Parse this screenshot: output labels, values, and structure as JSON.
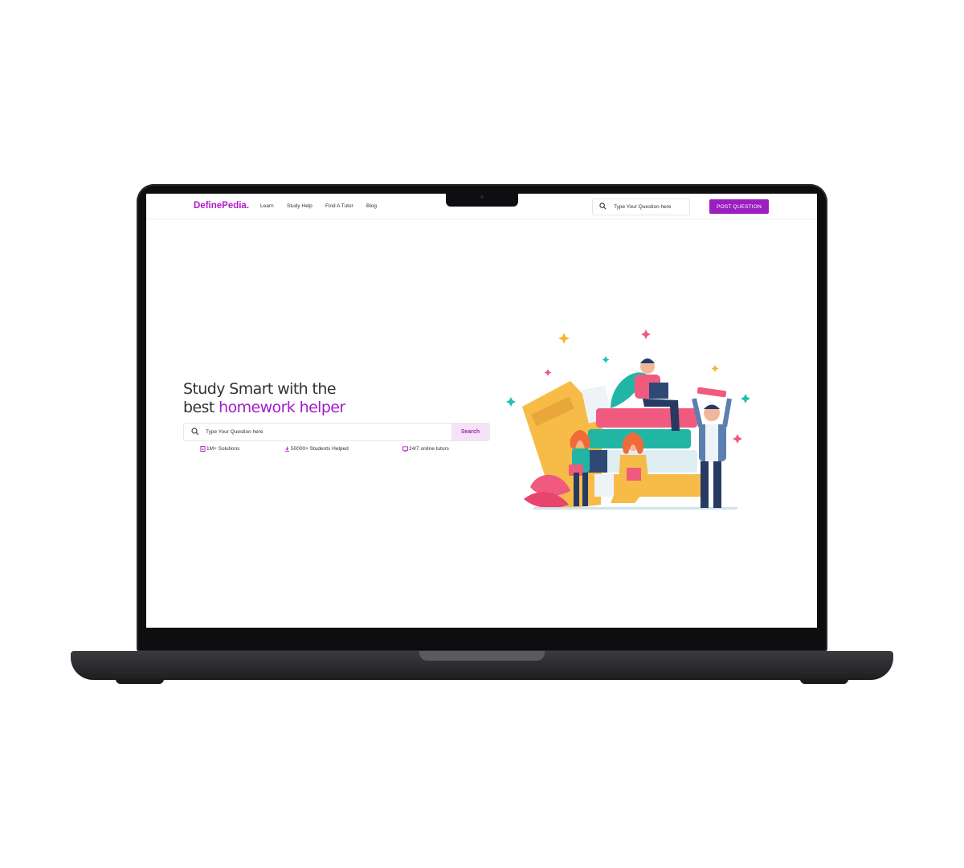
{
  "site": {
    "logo": "DefinePedia.",
    "brand_color": "#b219c8"
  },
  "nav": {
    "links": [
      "Learn",
      "Study Help",
      "Find A Tutor",
      "Blog"
    ],
    "search_placeholder": "Type Your Question here",
    "post_button": "POST QUESTION"
  },
  "hero": {
    "title_line1": "Study Smart with the",
    "title_line2_prefix": "best ",
    "title_line2_accent": "homework helper",
    "search_placeholder": "Type Your Question here",
    "search_button": "Search",
    "stats": [
      {
        "icon": "document-icon",
        "label": "1M+ Solutions"
      },
      {
        "icon": "download-icon",
        "label": "50000+ Students Helped"
      },
      {
        "icon": "monitor-icon",
        "label": "24/7 online tutors"
      }
    ]
  },
  "colors": {
    "accent": "#a21cc9",
    "button_bg": "#9b1ec0",
    "search_button_bg": "#f4e3f6"
  }
}
